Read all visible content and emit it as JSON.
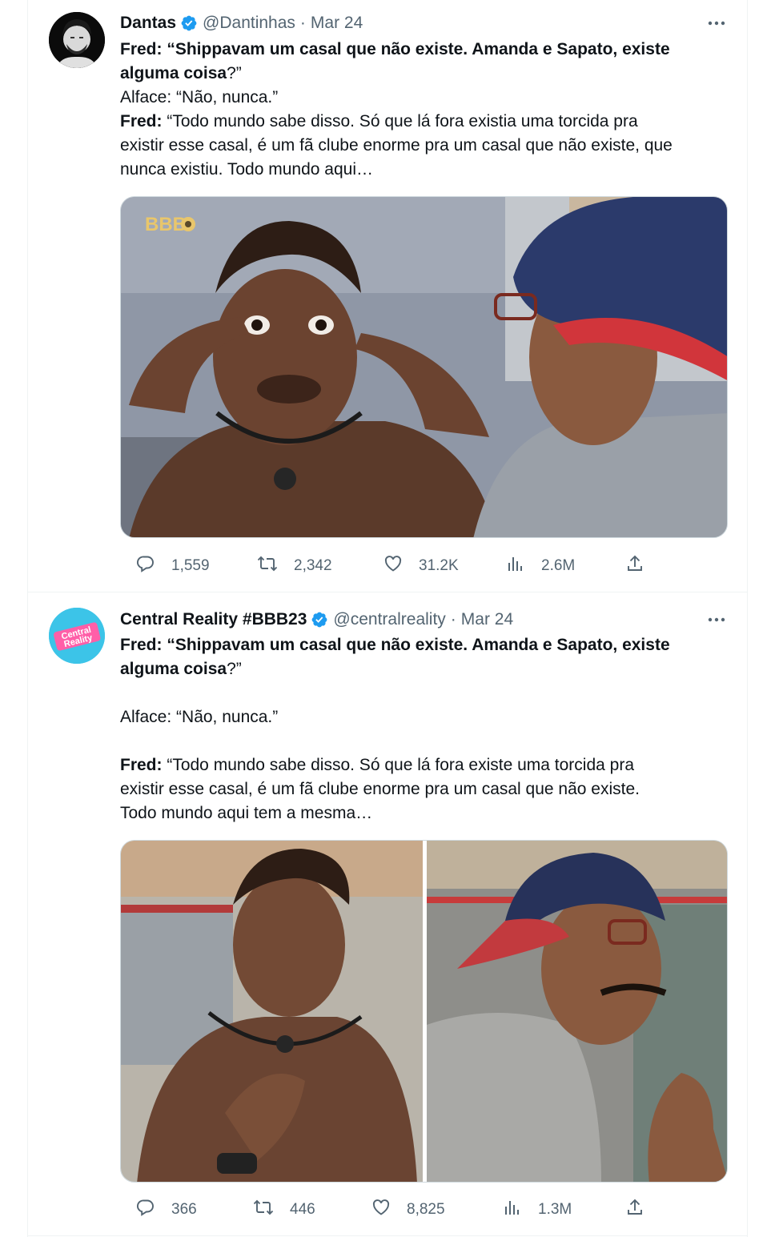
{
  "tweets": [
    {
      "name": "Dantas",
      "handle": "@Dantinhas",
      "separator": "·",
      "date": "Mar 24",
      "text": {
        "l1_bold": "Fred: “Shippavam um casal que não existe.  Amanda e Sapato, existe",
        "l2_bold": "alguma coisa",
        "l2_rest": "?”",
        "l3": "Alface: “Não, nunca.”",
        "l4_bold": "Fred:",
        "l4_rest": " “Todo mundo sabe disso. Só que lá fora existia uma torcida pra",
        "l5": "existir esse casal, é um fã clube enorme pra um casal que não existe, que",
        "l6": "nunca existiu. Todo mundo aqui…"
      },
      "media_watermark": "BBB",
      "stats": {
        "replies": "1,559",
        "retweets": "2,342",
        "likes": "31.2K",
        "views": "2.6M"
      }
    },
    {
      "name": "Central Reality #BBB23",
      "handle": "@centralreality",
      "separator": "·",
      "date": "Mar 24",
      "avatar_logo": "Central Reality",
      "text": {
        "l1_bold": "Fred: “Shippavam um casal que não existe. Amanda e Sapato, existe",
        "l2_bold": "alguma coisa",
        "l2_rest": "?”",
        "l3": "Alface: “Não, nunca.”",
        "l4_bold": "Fred:",
        "l4_rest": " “Todo mundo sabe disso. Só que lá fora existe uma torcida pra",
        "l5": "existir esse casal, é um fã clube enorme pra um casal que não existe.",
        "l6": "Todo mundo aqui tem a mesma…"
      },
      "stats": {
        "replies": "366",
        "retweets": "446",
        "likes": "8,825",
        "views": "1.3M"
      }
    }
  ],
  "colors": {
    "text_primary": "#0f1419",
    "text_secondary": "#536471",
    "verified": "#1d9bf0",
    "divider": "#eff3f4",
    "media_border": "#cfd9de"
  },
  "icons": [
    "verified-badge-icon",
    "more-icon",
    "reply-icon",
    "retweet-icon",
    "like-icon",
    "views-icon",
    "share-icon"
  ]
}
